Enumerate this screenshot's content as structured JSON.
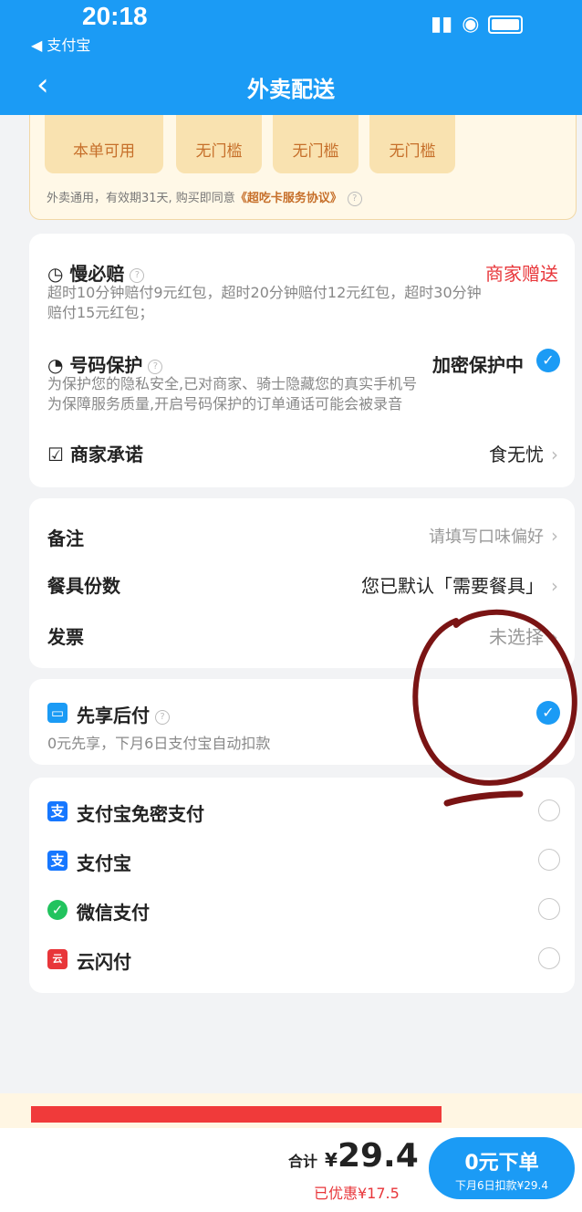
{
  "status_bar": {
    "time": "20:18",
    "back_app": "◀ 支付宝"
  },
  "nav": {
    "title": "外卖配送",
    "back_icon": "chevron-left-icon"
  },
  "coupons": [
    {
      "label": "本单可用"
    },
    {
      "label": "无门槛"
    },
    {
      "label": "无门槛"
    },
    {
      "label": "无门槛"
    }
  ],
  "coupon_note": {
    "text": "外卖通用，有效期31天, 购买即同意",
    "agreement": "《超吃卡服务协议》"
  },
  "services": {
    "slow": {
      "title": "慢必赔",
      "tag": "商家赠送",
      "desc1": "超时10分钟赔付9元红包，超时20分钟赔付12元红包，超时30分钟",
      "desc2": "赔付15元红包；"
    },
    "phone": {
      "title": "号码保护",
      "status": "加密保护中",
      "desc1": "为保护您的隐私安全,已对商家、骑士隐藏您的真实手机号",
      "desc2": "为保障服务质量,开启号码保护的订单通话可能会被录音"
    },
    "promise": {
      "title": "商家承诺",
      "value": "食无忧"
    }
  },
  "options": {
    "remark": {
      "label": "备注",
      "value": "请填写口味偏好"
    },
    "tableware": {
      "label": "餐具份数",
      "value": "您已默认「需要餐具」"
    },
    "invoice": {
      "label": "发票",
      "value": "未选择"
    }
  },
  "pay_later": {
    "title": "先享后付",
    "desc": "0元先享，下月6日支付宝自动扣款"
  },
  "payments": [
    {
      "label": "支付宝免密支付",
      "icon": "alipay-icon",
      "color": "#1677ff",
      "glyph": "支"
    },
    {
      "label": "支付宝",
      "icon": "alipay-icon",
      "color": "#1677ff",
      "glyph": "支"
    },
    {
      "label": "微信支付",
      "icon": "wechat-pay-icon",
      "color": "#22c35e",
      "glyph": "✓"
    },
    {
      "label": "云闪付",
      "icon": "unionpay-icon",
      "color": "#e8363a",
      "glyph": "云"
    }
  ],
  "footer": {
    "total_label": "合计",
    "total_currency": "¥",
    "total_value": "29.4",
    "discount": "已优惠¥17.5",
    "submit_label": "0元下单",
    "submit_sub": "下月6日扣款¥29.4"
  },
  "colors": {
    "primary": "#1b9bf5",
    "accent_red": "#e8363a",
    "coupon_text": "#c66f2a",
    "annotation": "#7a1414"
  }
}
